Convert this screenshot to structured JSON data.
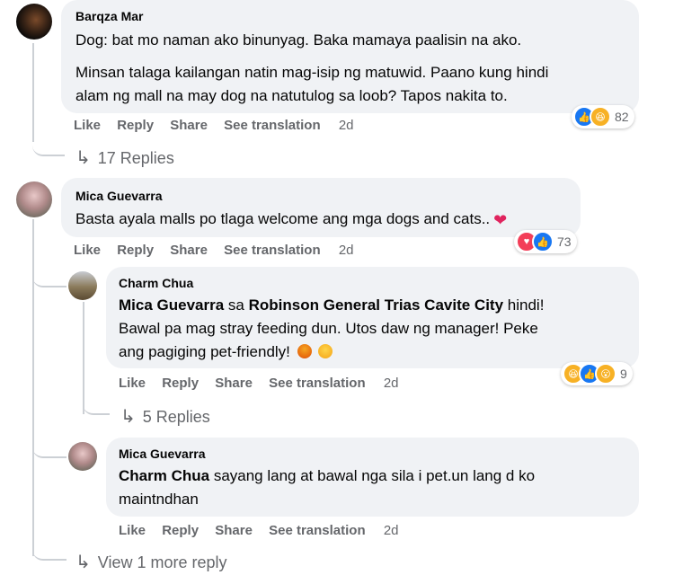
{
  "actions": {
    "like": "Like",
    "reply": "Reply",
    "share": "Share",
    "translate": "See translation"
  },
  "colors": {
    "like": "#1877f2",
    "love": "#f33e58",
    "haha": "#f7b125",
    "angry": "#e9710f"
  },
  "comments": [
    {
      "author": "Barqza Mar",
      "lines": [
        "Dog: bat mo naman ako binunyag. Baka mamaya paalisin na ako."
      ],
      "lines2": [
        "Minsan talaga kailangan natin mag-isip ng matuwid. Paano kung hindi",
        "alam ng mall na may dog na natutulog sa loob? Tapos nakita to."
      ],
      "time": "2d",
      "reaction_count": "82",
      "reaction_icons": [
        "like-icon",
        "haha-icon"
      ],
      "replies_label": "17 Replies"
    },
    {
      "author": "Mica Guevarra",
      "lines": [
        "Basta ayala malls po tlaga welcome ang mga dogs and cats.."
      ],
      "trailing_emoji": "heart-emoji",
      "time": "2d",
      "reaction_count": "73",
      "reaction_icons": [
        "love-icon",
        "like-icon"
      ],
      "replies": [
        {
          "author": "Charm Chua",
          "mention": "Mica Guevarra",
          "connector": "sa",
          "place": "Robinson General Trias Cavite City",
          "line1_rest": "hindi!",
          "line2": "Bawal pa mag stray feeding dun. Utos daw ng manager! Peke",
          "line3": "ang pagiging pet-friendly!",
          "time": "2d",
          "reaction_count": "9",
          "reaction_icons": [
            "haha-icon",
            "like-icon",
            "wow-icon"
          ],
          "replies_label": "5 Replies"
        },
        {
          "author": "Mica Guevarra",
          "mention": "Charm Chua",
          "line1_rest": "sayang lang at bawal nga sila i pet.un lang d ko",
          "line2": "maintndhan",
          "time": "2d"
        }
      ],
      "more_label": "View 1 more reply"
    }
  ]
}
